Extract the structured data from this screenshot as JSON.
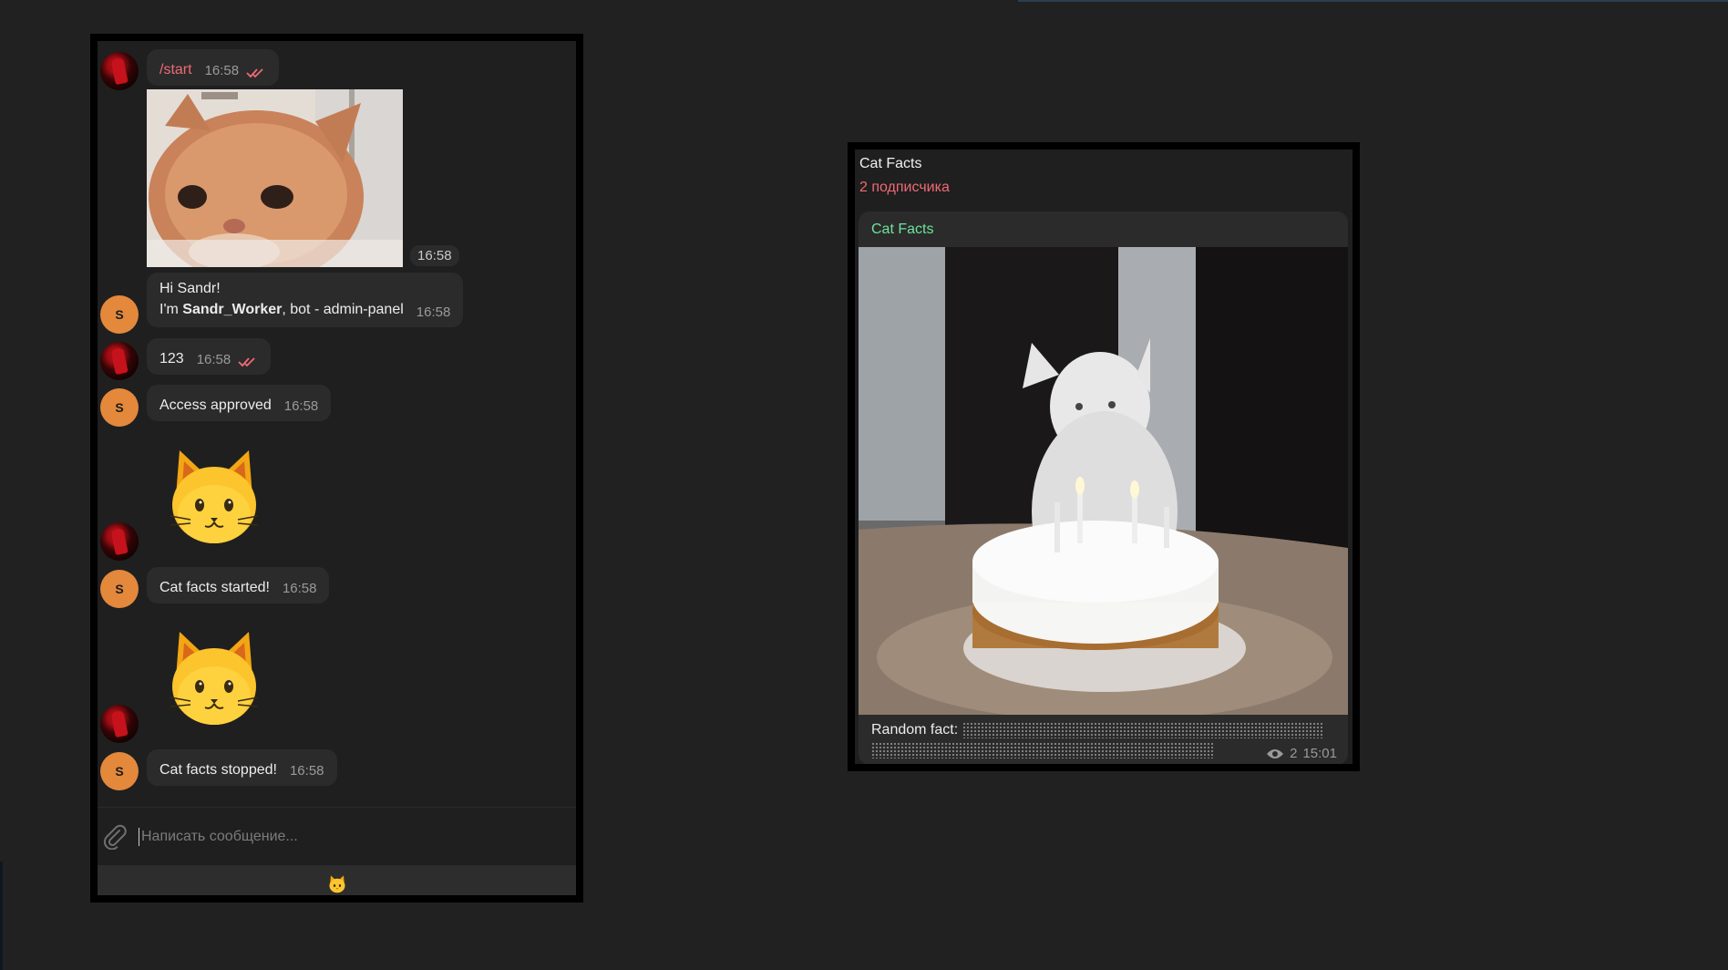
{
  "chat": {
    "messages": [
      {
        "text": "/start",
        "time": "16:58"
      },
      {
        "time": "16:58"
      },
      {
        "line1": "Hi Sandr!",
        "line2_prefix": "I'm ",
        "line2_bold": "Sandr_Worker",
        "line2_suffix": ", bot - admin-panel",
        "time": "16:58"
      },
      {
        "text": "123",
        "time": "16:58"
      },
      {
        "text": "Access approved",
        "time": "16:58"
      },
      {
        "text": "Cat facts started!",
        "time": "16:58"
      },
      {
        "text": "Cat facts stopped!",
        "time": "16:58"
      }
    ],
    "bot_avatar_letter": "S",
    "input_placeholder": "Написать сообщение...",
    "keyboard_button": "cat-emoji"
  },
  "channel": {
    "title": "Cat Facts",
    "subtitle": "2 подписчика",
    "post": {
      "author": "Cat Facts",
      "text_prefix": "Random fact:",
      "views": "2",
      "time": "15:01"
    }
  },
  "colors": {
    "background": "#212121",
    "bubble": "#2b2b2b",
    "accent_red": "#ef6a75",
    "author_green": "#6ee39a",
    "bot_avatar": "#e4883c"
  }
}
